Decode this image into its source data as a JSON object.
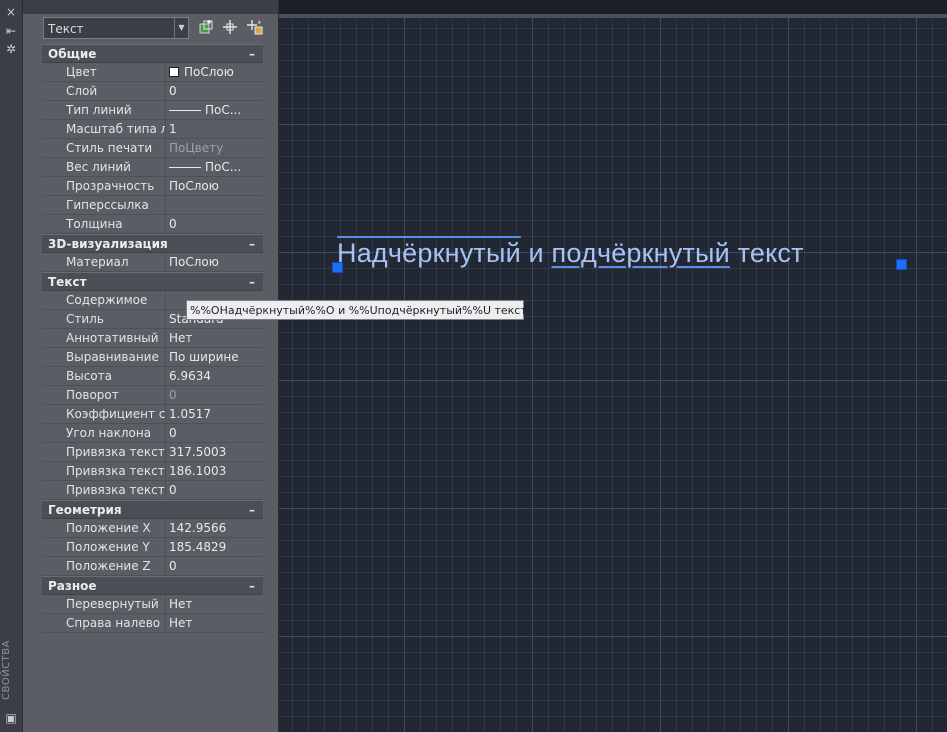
{
  "canvas": {
    "text_pre": "",
    "text_over": "Надчёркнутый",
    "text_mid": " и ",
    "text_under": "подчёркнутый",
    "text_post": " текст"
  },
  "strip": {
    "close_icon": "×",
    "pin_icon": "⇤",
    "options_icon": "✲",
    "label": "СВОЙСТВА",
    "bottom_icon": "▣"
  },
  "palette": {
    "selector_value": "Текст",
    "tools": [
      "add-selection-icon",
      "select-objects-icon",
      "quick-select-icon"
    ],
    "categories": [
      {
        "title": "Общие",
        "toggle": "–",
        "rows": [
          {
            "label": "Цвет",
            "value": "ПоСлою",
            "kind": "swatch"
          },
          {
            "label": "Слой",
            "value": "0"
          },
          {
            "label": "Тип линий",
            "value": "ПоС...",
            "kind": "line"
          },
          {
            "label": "Масштаб типа лин...",
            "value": "1"
          },
          {
            "label": "Стиль печати",
            "value": "ПоЦвету",
            "kind": "gray"
          },
          {
            "label": "Вес линий",
            "value": "ПоС...",
            "kind": "line"
          },
          {
            "label": "Прозрачность",
            "value": "ПоСлою"
          },
          {
            "label": "Гиперссылка",
            "value": ""
          },
          {
            "label": "Толщина",
            "value": "0"
          }
        ]
      },
      {
        "title": "3D-визуализация",
        "toggle": "–",
        "rows": [
          {
            "label": "Материал",
            "value": "ПоСлою"
          }
        ]
      },
      {
        "title": "Текст",
        "toggle": "–",
        "rows": [
          {
            "label": "Содержимое",
            "value": ""
          },
          {
            "label": "Стиль",
            "value": "Standard"
          },
          {
            "label": "Аннотативный",
            "value": "Нет"
          },
          {
            "label": "Выравнивание",
            "value": "По ширине"
          },
          {
            "label": "Высота",
            "value": "6.9634"
          },
          {
            "label": "Поворот",
            "value": "0",
            "kind": "gray"
          },
          {
            "label": "Коэффициент сжат...",
            "value": "1.0517"
          },
          {
            "label": "Угол наклона",
            "value": "0"
          },
          {
            "label": "Привязка текста по...",
            "value": "317.5003"
          },
          {
            "label": "Привязка текста по...",
            "value": "186.1003"
          },
          {
            "label": "Привязка текста по...",
            "value": "0"
          }
        ]
      },
      {
        "title": "Геометрия",
        "toggle": "–",
        "rows": [
          {
            "label": "Положение X",
            "value": "142.9566"
          },
          {
            "label": "Положение Y",
            "value": "185.4829"
          },
          {
            "label": "Положение Z",
            "value": "0"
          }
        ]
      },
      {
        "title": "Разное",
        "toggle": "–",
        "rows": [
          {
            "label": "Перевернутый",
            "value": "Нет"
          },
          {
            "label": "Справа налево",
            "value": "Нет"
          }
        ]
      }
    ],
    "contents_edit": "%%OНадчёркнутый%%O и %%Uподчёркнутый%%U текст"
  }
}
